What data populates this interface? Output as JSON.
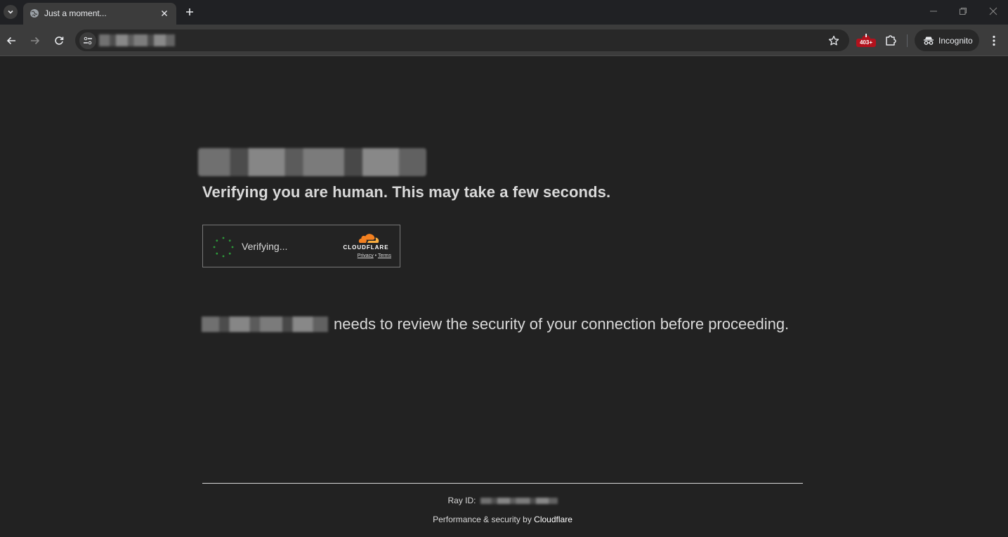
{
  "tab": {
    "title": "Just a moment..."
  },
  "toolbar": {
    "incognito_label": "Incognito",
    "extension_badge": "403+"
  },
  "page": {
    "heading": "Verifying you are human. This may take a few seconds.",
    "widget": {
      "status": "Verifying...",
      "brand": "CLOUDFLARE",
      "privacy": "Privacy",
      "separator": "•",
      "terms": "Terms"
    },
    "review_text": "needs to review the security of your connection before proceeding.",
    "ray_label": "Ray ID:",
    "footer_prefix": "Performance & security by",
    "footer_brand": "Cloudflare"
  },
  "colors": {
    "background": "#222222",
    "text": "#d9d9d9",
    "accent_orange": "#f38020",
    "badge_red": "#b3121d",
    "spinner_green": "#2d9a3a"
  },
  "icons": [
    "tab-search-icon",
    "globe-icon",
    "close-icon",
    "plus-icon",
    "minimize-icon",
    "restore-icon",
    "back-arrow-icon",
    "forward-arrow-icon",
    "reload-icon",
    "site-info-icon",
    "star-icon",
    "extension-icon",
    "puzzle-icon",
    "incognito-icon",
    "kebab-menu-icon",
    "cloudflare-logo",
    "spinner-icon"
  ]
}
